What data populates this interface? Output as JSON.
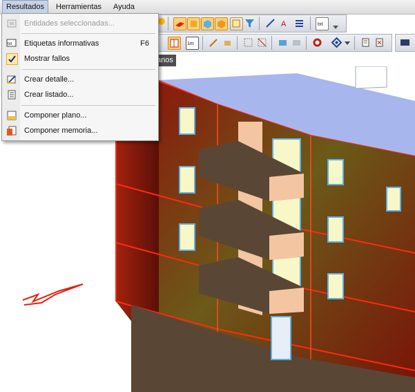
{
  "menubar": {
    "items": [
      {
        "label": "Resultados"
      },
      {
        "label": "Herramientas"
      },
      {
        "label": "Ayuda"
      }
    ]
  },
  "dropdown": {
    "items": [
      {
        "label": "Entidades seleccionadas...",
        "shortcut": "",
        "icon": "selected-entities-icon",
        "disabled": true
      },
      {
        "label": "Etiquetas informativas",
        "shortcut": "F6",
        "icon": "info-labels-icon",
        "disabled": false
      },
      {
        "label": "Mostrar fallos",
        "shortcut": "",
        "icon": "checkmark-icon",
        "disabled": false,
        "checked": true
      },
      {
        "label": "Crear detalle...",
        "shortcut": "",
        "icon": "detail-icon",
        "disabled": false
      },
      {
        "label": "Crear listado...",
        "shortcut": "",
        "icon": "list-icon",
        "disabled": false
      },
      {
        "label": "Componer plano...",
        "shortcut": "",
        "icon": "compose-plan-icon",
        "disabled": false
      },
      {
        "label": "Componer memoria...",
        "shortcut": "",
        "icon": "compose-report-icon",
        "disabled": false
      }
    ]
  },
  "viewport": {
    "tab_label": "anos"
  },
  "colors": {
    "menu_active": "#c7d2e5",
    "facade_dark": "#6a0f0a",
    "facade_mid": "#a8300f",
    "roof": "#a8b6ee",
    "balcony": "#f3c6a1",
    "slab_edge": "#ff2a10",
    "window_glass": "#f7f7c8"
  }
}
